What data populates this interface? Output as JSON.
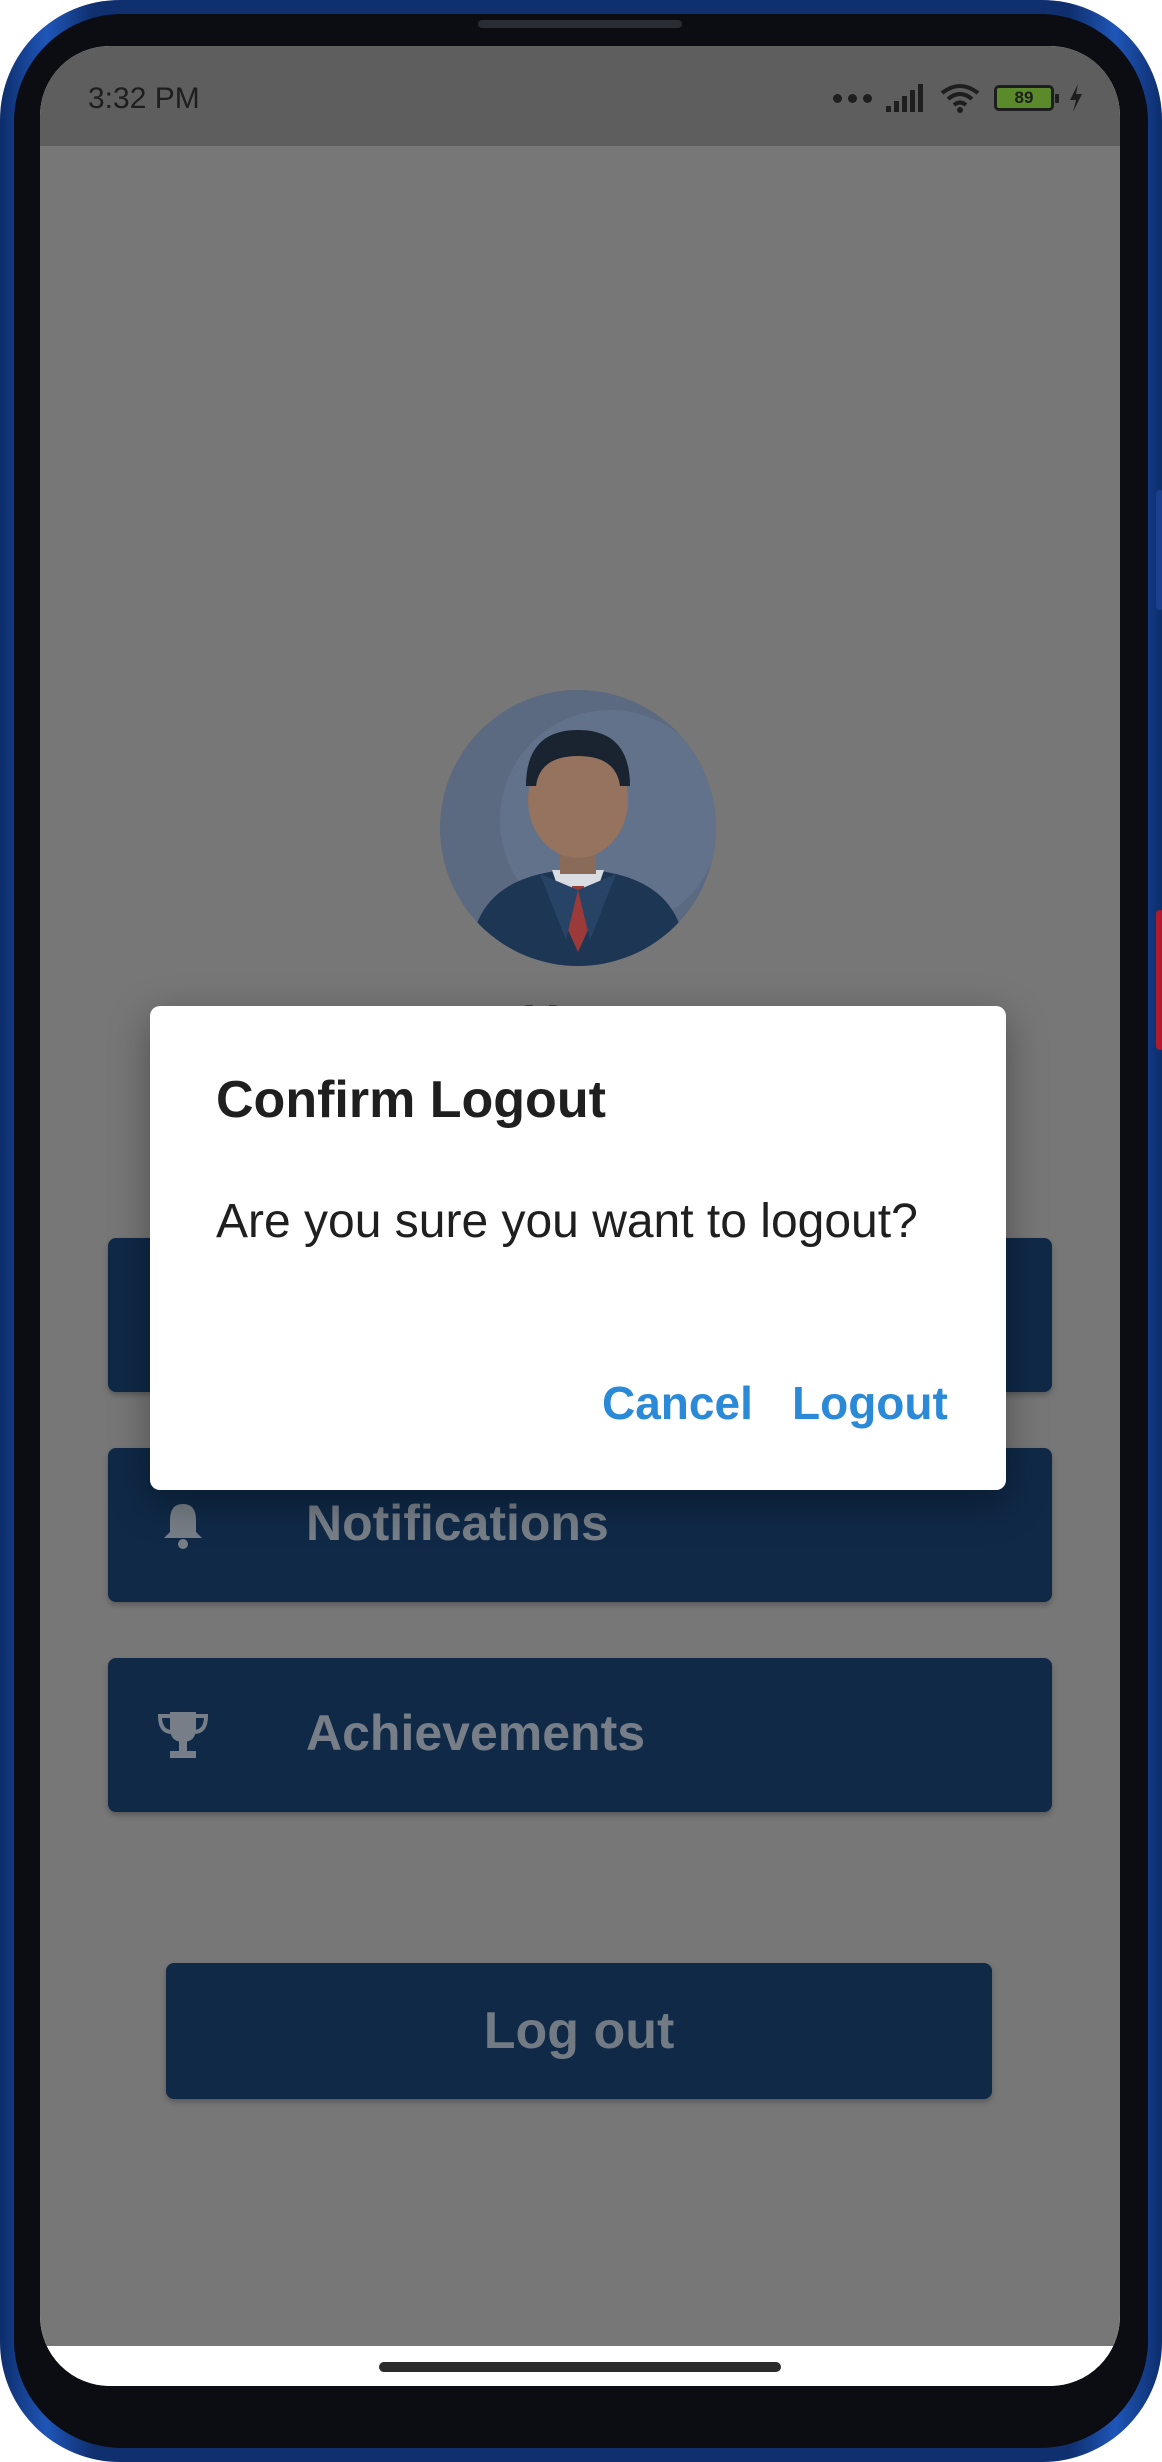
{
  "status_bar": {
    "time": "3:32 PM",
    "battery_level": "89"
  },
  "profile": {
    "name": "User"
  },
  "menu": {
    "items": [
      {
        "label": "",
        "icon": "person-icon"
      },
      {
        "label": "Notifications",
        "icon": "bell-icon"
      },
      {
        "label": "Achievements",
        "icon": "trophy-icon"
      }
    ]
  },
  "logout_button": {
    "label": "Log out"
  },
  "dialog": {
    "title": "Confirm Logout",
    "message": "Are you sure you want to logout?",
    "cancel_label": "Cancel",
    "confirm_label": "Logout"
  },
  "colors": {
    "primary": "#0f2947",
    "accent": "#2a8ad8",
    "scrim": "#777777"
  }
}
